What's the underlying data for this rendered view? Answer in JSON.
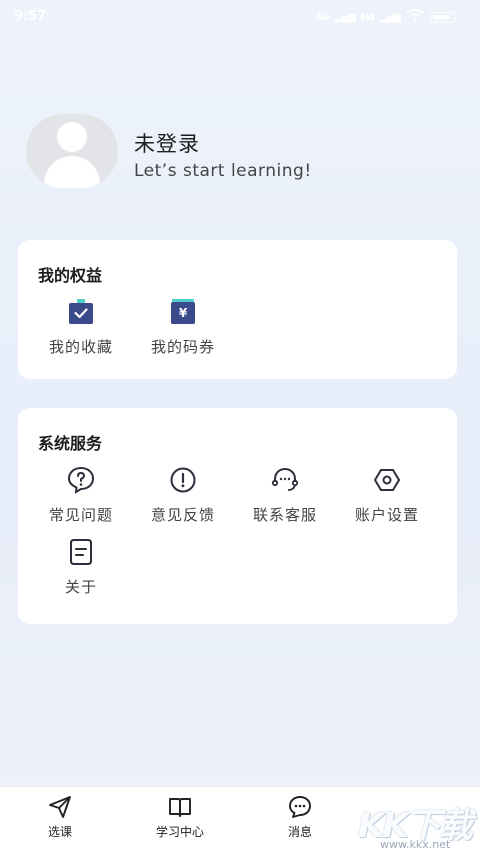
{
  "status_bar": {
    "time": "9:57",
    "signal_labels": [
      "4G",
      "Hd"
    ]
  },
  "profile": {
    "name": "未登录",
    "subtitle": "Let’s start learning!"
  },
  "benefits": {
    "title": "我的权益",
    "items": [
      {
        "label": "我的收藏",
        "icon": "favorites-icon"
      },
      {
        "label": "我的码券",
        "icon": "coupon-icon"
      }
    ]
  },
  "services": {
    "title": "系统服务",
    "items": [
      {
        "label": "常见问题",
        "icon": "question-icon"
      },
      {
        "label": "意见反馈",
        "icon": "feedback-icon"
      },
      {
        "label": "联系客服",
        "icon": "customer-service-icon"
      },
      {
        "label": "账户设置",
        "icon": "settings-icon"
      },
      {
        "label": "关于",
        "icon": "about-icon"
      }
    ]
  },
  "bottom_nav": {
    "items": [
      {
        "label": "选课",
        "icon": "send-icon"
      },
      {
        "label": "学习中心",
        "icon": "book-icon"
      },
      {
        "label": "消息",
        "icon": "message-icon"
      }
    ]
  },
  "watermark": {
    "text": "KK下载",
    "url": "www.kkx.net"
  },
  "colors": {
    "accent": "#3b4a8a",
    "accent_teal": "#4fd1c5",
    "background": "#eaf0fa"
  }
}
